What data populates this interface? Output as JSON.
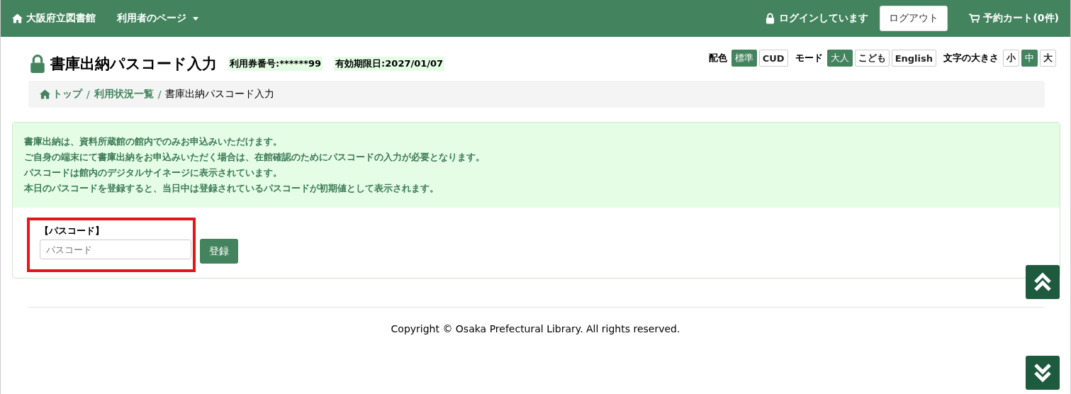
{
  "navbar": {
    "brand": "大阪府立図書館",
    "user_menu": "利用者のページ",
    "login_status": "ログインしています",
    "logout": "ログアウト",
    "cart": "予約カート(0件)"
  },
  "page_title": "書庫出納パスコード入力",
  "card_number": "利用券番号:******99",
  "expiry": "有効期限日:2027/01/07",
  "settings": [
    {
      "label": "配色",
      "options": [
        {
          "label": "標準",
          "selected": true
        },
        {
          "label": "CUD",
          "selected": false
        }
      ]
    },
    {
      "label": "モード",
      "options": [
        {
          "label": "大人",
          "selected": true
        },
        {
          "label": "こども",
          "selected": false
        },
        {
          "label": "English",
          "selected": false
        }
      ]
    },
    {
      "label": "文字の大きさ",
      "options": [
        {
          "label": "小",
          "selected": false
        },
        {
          "label": "中",
          "selected": true
        },
        {
          "label": "大",
          "selected": false
        }
      ]
    }
  ],
  "breadcrumb_separator": "/",
  "breadcrumb": [
    {
      "label": "トップ",
      "kind": "home"
    },
    {
      "label": "利用状況一覧",
      "kind": "link"
    },
    {
      "label": "書庫出納パスコード入力",
      "kind": "current"
    }
  ],
  "notice": [
    "書庫出納は、資料所蔵館の館内でのみお申込みいただけます。",
    "ご自身の端末にて書庫出納をお申込みいただく場合は、在館確認のためにパスコードの入力が必要となります。",
    "パスコードは館内のデジタルサイネージに表示されています。",
    "本日のパスコードを登録すると、当日中は登録されているパスコードが初期値として表示されます。"
  ],
  "passcode_field": {
    "label": "【パスコード】",
    "placeholder": "パスコード"
  },
  "submit": "登録",
  "footer": "Copyright © Osaka Prefectural Library. All rights reserved."
}
